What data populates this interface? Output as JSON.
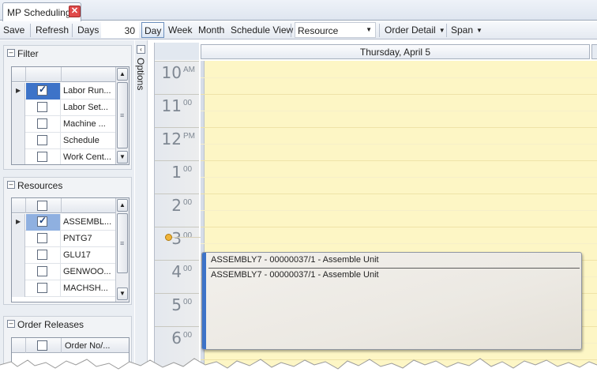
{
  "tab": {
    "title": "MP Scheduling",
    "close": "✕"
  },
  "toolbar": {
    "save": "Save",
    "refresh": "Refresh",
    "days_label": "Days",
    "days_value": "30",
    "day": "Day",
    "week": "Week",
    "month": "Month",
    "schedule_view": "Schedule View",
    "view_combo": "Resource",
    "order_detail": "Order Detail",
    "span": "Span"
  },
  "filter": {
    "title": "Filter",
    "rows": [
      {
        "label": "Labor Run...",
        "checked": true
      },
      {
        "label": "Labor Set...",
        "checked": false
      },
      {
        "label": "Machine ...",
        "checked": false
      },
      {
        "label": "Schedule",
        "checked": false
      },
      {
        "label": "Work Cent...",
        "checked": false
      }
    ]
  },
  "resources": {
    "title": "Resources",
    "rows": [
      {
        "label": "ASSEMBL...",
        "checked": true
      },
      {
        "label": "PNTG7",
        "checked": false
      },
      {
        "label": "GLU17",
        "checked": false
      },
      {
        "label": "GENWOO...",
        "checked": false
      },
      {
        "label": "MACHSH...",
        "checked": false
      }
    ]
  },
  "order_releases": {
    "title": "Order Releases",
    "column": "Order No/..."
  },
  "options": {
    "label": "Options"
  },
  "calendar": {
    "date_header": "Thursday, April 5",
    "hours": [
      {
        "hour": "10",
        "suffix": "AM"
      },
      {
        "hour": "11",
        "suffix": "00"
      },
      {
        "hour": "12",
        "suffix": "PM"
      },
      {
        "hour": "1",
        "suffix": "00"
      },
      {
        "hour": "2",
        "suffix": "00"
      },
      {
        "hour": "3",
        "suffix": "00"
      },
      {
        "hour": "4",
        "suffix": "00"
      },
      {
        "hour": "5",
        "suffix": "00"
      },
      {
        "hour": "6",
        "suffix": "00"
      }
    ],
    "appointment": {
      "title": "ASSEMBLY7 - 00000037/1 - Assemble Unit",
      "subtitle": "ASSEMBLY7 - 00000037/1 - Assemble Unit"
    }
  },
  "colors": {
    "accent": "#3d73c8",
    "calendar_bg": "#fdf6c5",
    "tab_close": "#e04a4a"
  }
}
